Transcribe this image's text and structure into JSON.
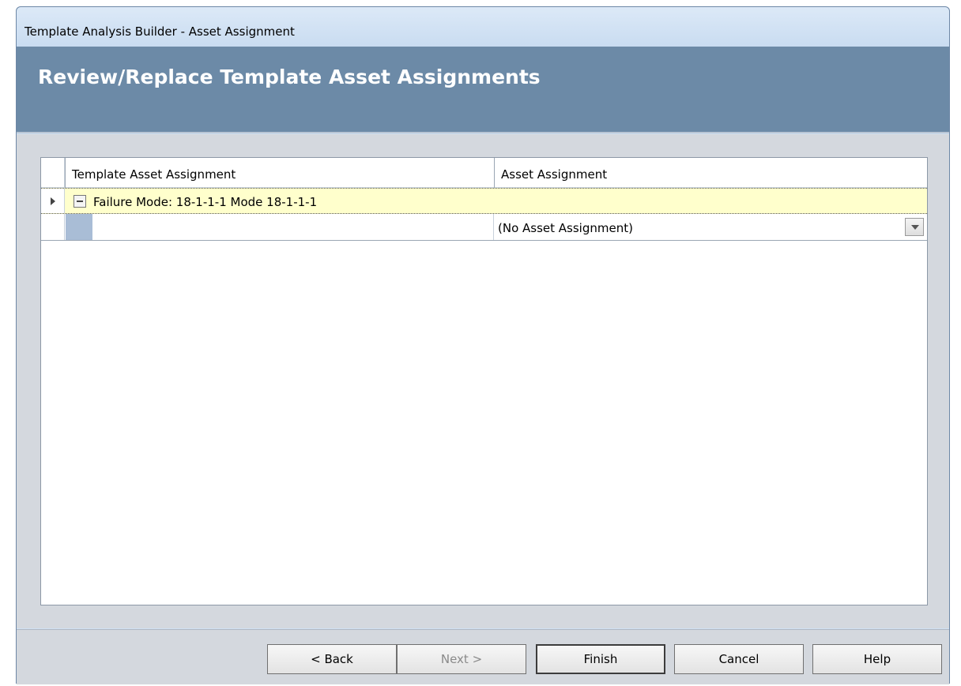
{
  "window": {
    "title": "Template Analysis Builder - Asset Assignment"
  },
  "banner": {
    "title": "Review/Replace Template Asset Assignments"
  },
  "grid": {
    "columns": [
      "Template Asset Assignment",
      "Asset Assignment"
    ],
    "group_row": {
      "label": "Failure Mode: 18-1-1-1 Mode 18-1-1-1"
    },
    "rows": [
      {
        "template_asset_assignment": "",
        "asset_assignment": "(No Asset Assignment)"
      }
    ]
  },
  "buttons": {
    "back": "< Back",
    "next": "Next >",
    "finish": "Finish",
    "cancel": "Cancel",
    "help": "Help"
  }
}
